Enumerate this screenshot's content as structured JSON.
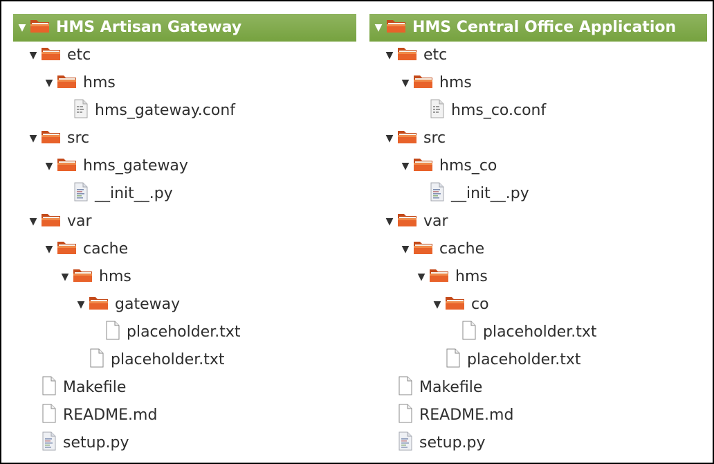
{
  "left_tree": {
    "root": "HMS Artisan Gateway",
    "items": [
      {
        "label": "etc",
        "type": "folder",
        "depth": 1,
        "expanded": true
      },
      {
        "label": "hms",
        "type": "folder",
        "depth": 2,
        "expanded": true
      },
      {
        "label": "hms_gateway.conf",
        "type": "config",
        "depth": 3
      },
      {
        "label": "src",
        "type": "folder",
        "depth": 1,
        "expanded": true
      },
      {
        "label": "hms_gateway",
        "type": "folder",
        "depth": 2,
        "expanded": true
      },
      {
        "label": "__init__.py",
        "type": "script",
        "depth": 3
      },
      {
        "label": "var",
        "type": "folder",
        "depth": 1,
        "expanded": true
      },
      {
        "label": "cache",
        "type": "folder",
        "depth": 2,
        "expanded": true
      },
      {
        "label": "hms",
        "type": "folder",
        "depth": 3,
        "expanded": true
      },
      {
        "label": "gateway",
        "type": "folder",
        "depth": 4,
        "expanded": true
      },
      {
        "label": "placeholder.txt",
        "type": "file",
        "depth": 5
      },
      {
        "label": "placeholder.txt",
        "type": "file",
        "depth": 4
      },
      {
        "label": "Makefile",
        "type": "file",
        "depth": 1
      },
      {
        "label": "README.md",
        "type": "file",
        "depth": 1
      },
      {
        "label": "setup.py",
        "type": "script",
        "depth": 1
      }
    ]
  },
  "right_tree": {
    "root": "HMS Central Office Application",
    "items": [
      {
        "label": "etc",
        "type": "folder",
        "depth": 1,
        "expanded": true
      },
      {
        "label": "hms",
        "type": "folder",
        "depth": 2,
        "expanded": true
      },
      {
        "label": "hms_co.conf",
        "type": "config",
        "depth": 3
      },
      {
        "label": "src",
        "type": "folder",
        "depth": 1,
        "expanded": true
      },
      {
        "label": "hms_co",
        "type": "folder",
        "depth": 2,
        "expanded": true
      },
      {
        "label": "__init__.py",
        "type": "script",
        "depth": 3
      },
      {
        "label": "var",
        "type": "folder",
        "depth": 1,
        "expanded": true
      },
      {
        "label": "cache",
        "type": "folder",
        "depth": 2,
        "expanded": true
      },
      {
        "label": "hms",
        "type": "folder",
        "depth": 3,
        "expanded": true
      },
      {
        "label": "co",
        "type": "folder",
        "depth": 4,
        "expanded": true
      },
      {
        "label": "placeholder.txt",
        "type": "file",
        "depth": 5
      },
      {
        "label": "placeholder.txt",
        "type": "file",
        "depth": 4
      },
      {
        "label": "Makefile",
        "type": "file",
        "depth": 1
      },
      {
        "label": "README.md",
        "type": "file",
        "depth": 1
      },
      {
        "label": "setup.py",
        "type": "script",
        "depth": 1
      }
    ]
  },
  "colors": {
    "header_bg": "#7ea849",
    "header_text": "#ffffff",
    "folder_orange": "#e8622a",
    "text": "#2e2e2e"
  },
  "icons": {
    "folder": "folder-icon",
    "file": "text-file-icon",
    "config": "config-file-icon",
    "script": "python-script-icon",
    "expand": "expanded-arrow-icon"
  }
}
